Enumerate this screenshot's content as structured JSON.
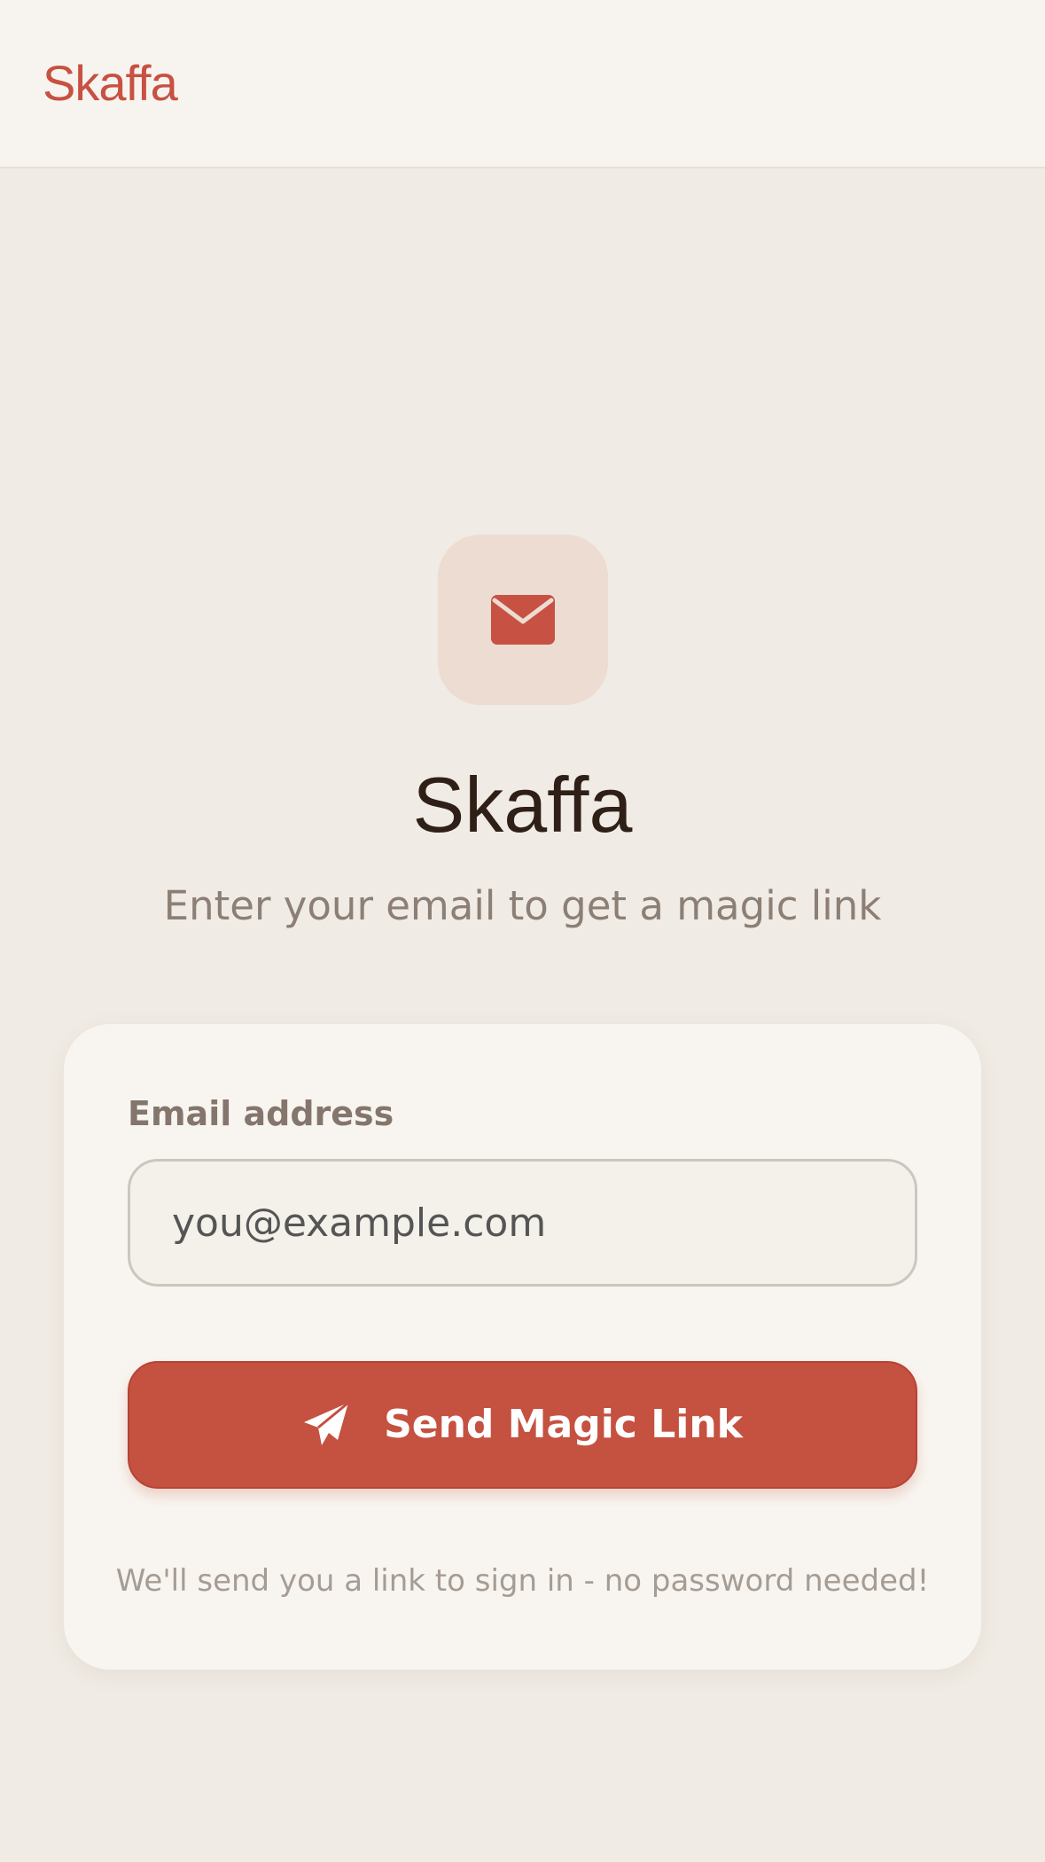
{
  "header": {
    "brand": "Skaffa"
  },
  "hero": {
    "icon": "envelope-icon",
    "title": "Skaffa",
    "subtitle": "Enter your email to get a magic link"
  },
  "form": {
    "email_label": "Email address",
    "email_placeholder": "you@example.com",
    "email_value": "",
    "submit_label": "Send Magic Link",
    "submit_icon": "paper-plane-icon",
    "hint": "We'll send you a link to sign in - no password needed!"
  },
  "colors": {
    "accent": "#C55141",
    "background": "#F0EBE4",
    "surface": "#F8F5F0",
    "title_text": "#2E1F17"
  }
}
